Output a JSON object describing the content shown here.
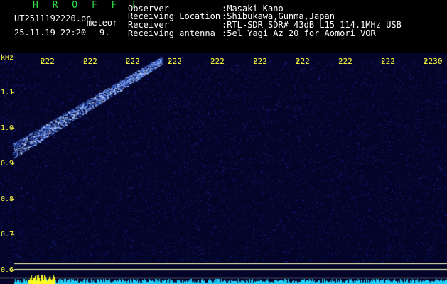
{
  "header": {
    "program": "H R O F F T",
    "filename": "UT2511192220.pn",
    "mode": "meteor",
    "date_time": "25.11.19 22:20",
    "count": "9.",
    "fields": [
      {
        "label": "Observer",
        "value": ":Masaki Kano"
      },
      {
        "label": "Receiving Location",
        "value": ":Shibukawa,Gunma,Japan"
      },
      {
        "label": "Receiver",
        "value": ":RTL-SDR SDR# 43dB L15 114.1MHz USB"
      },
      {
        "label": "Receiving antenna",
        "value": ":5el Yagi Az 20 for Aomori VOR"
      }
    ]
  },
  "plot": {
    "y_unit": "kHz",
    "y_ticks": [
      "1.1",
      "1.0",
      "0.9",
      "0.8",
      "0.7",
      "0.6"
    ],
    "x_ticks": [
      "222",
      "222",
      "222",
      "222",
      "222",
      "222",
      "222",
      "222",
      "222",
      "2230"
    ],
    "colors": {
      "background": "#040428",
      "noise": "#1c2a9a",
      "signal": "#6aa0ff",
      "hot": "#d8e8ff",
      "grid": "#ffffc0",
      "baseline": "#20d0ff",
      "burst": "#ffff20",
      "label": "#ffff40"
    }
  }
}
